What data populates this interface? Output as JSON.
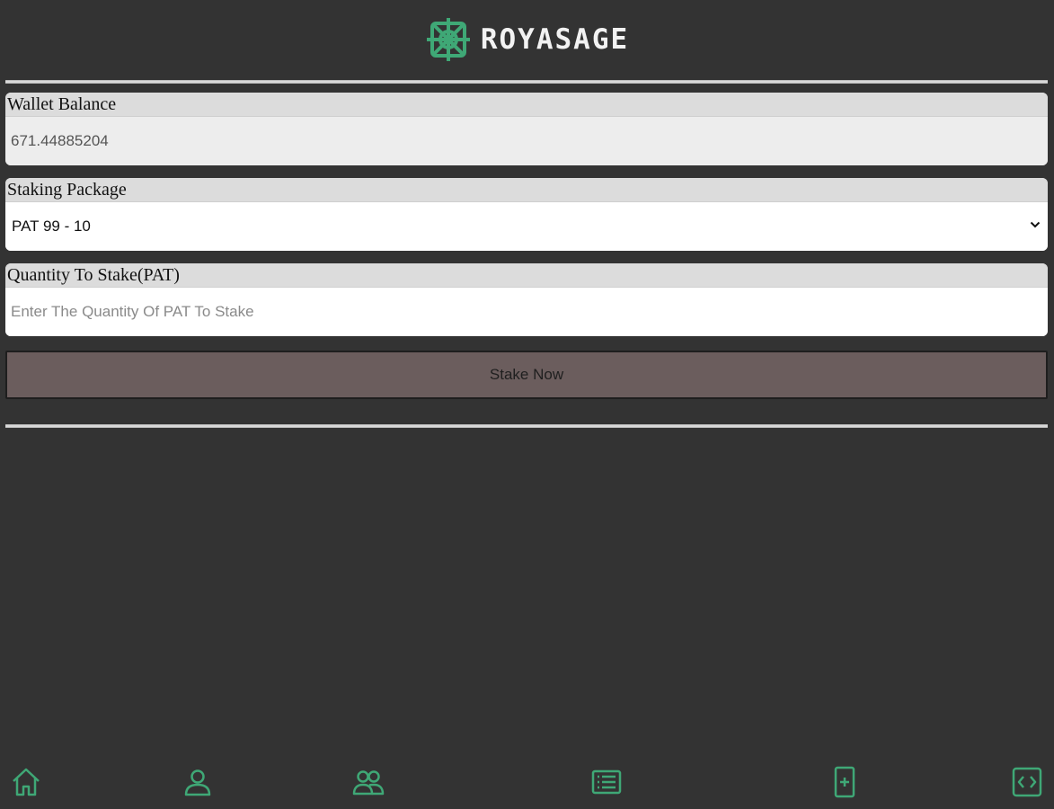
{
  "brand": {
    "name": "ROYASAGE",
    "accent": "#3fa876"
  },
  "wallet": {
    "label": "Wallet Balance",
    "value": "671.44885204"
  },
  "package": {
    "label": "Staking Package",
    "selected": "PAT 99 - 10"
  },
  "quantity": {
    "label": "Quantity To Stake(PAT)",
    "placeholder": "Enter The Quantity Of PAT To Stake"
  },
  "actions": {
    "stake_label": "Stake Now"
  },
  "nav": {
    "items": [
      {
        "icon": "home-icon"
      },
      {
        "icon": "user-icon"
      },
      {
        "icon": "users-icon"
      },
      {
        "icon": "list-icon"
      },
      {
        "icon": "add-document-icon"
      },
      {
        "icon": "code-icon"
      }
    ]
  }
}
